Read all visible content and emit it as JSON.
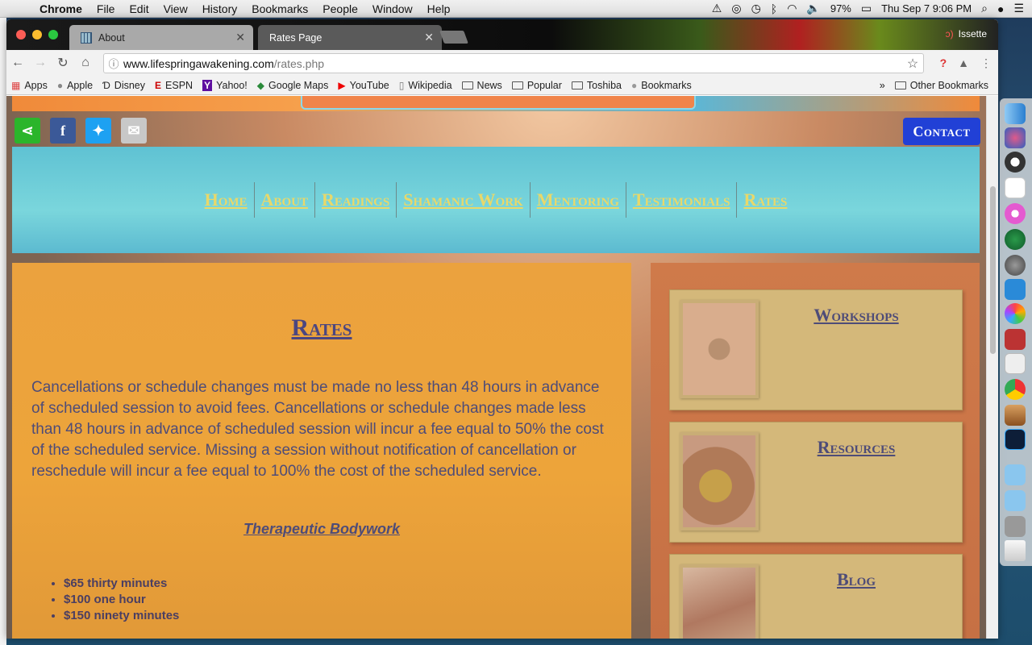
{
  "menubar": {
    "app": "Chrome",
    "items": [
      "File",
      "Edit",
      "View",
      "History",
      "Bookmarks",
      "People",
      "Window",
      "Help"
    ],
    "battery": "97%",
    "clock": "Thu Sep 7  9:06 PM"
  },
  "tabs": [
    {
      "label": "About"
    },
    {
      "label": "Rates Page"
    }
  ],
  "profile": {
    "name": "Issette"
  },
  "omnibox": {
    "host": "www.lifespringawakening.com",
    "path": "/rates.php"
  },
  "bookmarks": {
    "items": [
      "Apps",
      "Apple",
      "Disney",
      "ESPN",
      "Yahoo!",
      "Google Maps",
      "YouTube",
      "Wikipedia",
      "News",
      "Popular",
      "Toshiba",
      "Bookmarks"
    ],
    "overflow": "»",
    "other": "Other Bookmarks"
  },
  "page": {
    "contact_label": "Contact",
    "nav": [
      "Home",
      "About",
      "Readings",
      "Shamanic Work",
      "Mentoring",
      "Testimonials",
      "Rates"
    ],
    "main": {
      "title": "Rates",
      "paragraph": "Cancellations or schedule changes must be made no less than 48 hours in advance of scheduled session to avoid fees. Cancellations or schedule changes made less than 48 hours in advance of scheduled session will incur a fee equal to 50% the cost of the scheduled service. Missing a session without notification of cancellation or reschedule will incur a fee equal to 100% the cost of the scheduled service.",
      "section_title": "Therapeutic Bodywork",
      "prices": [
        "$65 thirty minutes",
        "$100 one hour",
        "$150 ninety minutes"
      ]
    },
    "sidebar": [
      {
        "title": "Workshops"
      },
      {
        "title": "Resources"
      },
      {
        "title": "Blog"
      }
    ]
  },
  "colors": {
    "nav_link": "#e8d86a",
    "content_text": "#4e4c78",
    "contact_button": "#2140d6"
  }
}
